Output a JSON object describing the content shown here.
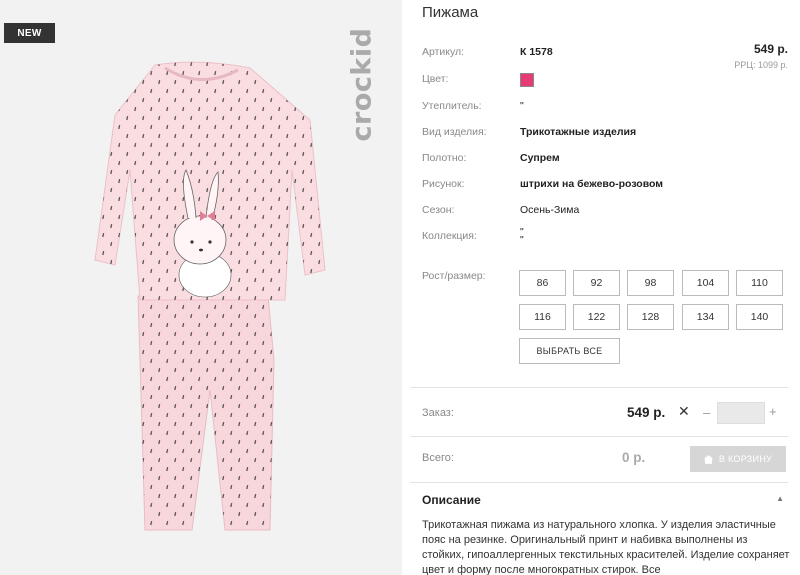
{
  "badge": {
    "label": "NEW"
  },
  "brand": {
    "name": "crockid"
  },
  "product": {
    "title": "Пижама",
    "price": "549 р.",
    "rrp": "РРЦ: 1099 р."
  },
  "colors": {
    "swatch": "#ea3a76",
    "accent_bg": "#333333"
  },
  "attributes": [
    {
      "label": "Артикул:",
      "value": "К 1578"
    },
    {
      "label": "Цвет:",
      "value": ""
    },
    {
      "label": "Утеплитель:",
      "value": "\""
    },
    {
      "label": "Вид изделия:",
      "value": "Трикотажные изделия"
    },
    {
      "label": "Полотно:",
      "value": "Супрем"
    },
    {
      "label": "Рисунок:",
      "value": "штрихи на бежево-розовом"
    },
    {
      "label": "Сезон:",
      "value": "Осень-Зима"
    },
    {
      "label": "Коллекция:",
      "value": "\"\n\""
    }
  ],
  "sizes": {
    "label": "Рост/размер:",
    "options": [
      "86",
      "92",
      "98",
      "104",
      "110",
      "116",
      "122",
      "128",
      "134",
      "140"
    ],
    "select_all": "ВЫБРАТЬ ВСЕ"
  },
  "order": {
    "label": "Заказ:",
    "price": "549 р.",
    "times": "✕",
    "minus": "–",
    "plus": "+",
    "quantity": ""
  },
  "total": {
    "label": "Всего:",
    "value": "0 р.",
    "cart_button": "В КОРЗИНУ"
  },
  "description": {
    "heading": "Описание",
    "toggle": "▲",
    "text": "Трикотажная пижама из натурального хлопка. У изделия эластичные пояс на резинке. Оригинальный принт и набивка выполнены из стойких, гипоаллергенных текстильных красителей. Изделие сохраняет цвет и форму после многократных стирок. Все"
  }
}
